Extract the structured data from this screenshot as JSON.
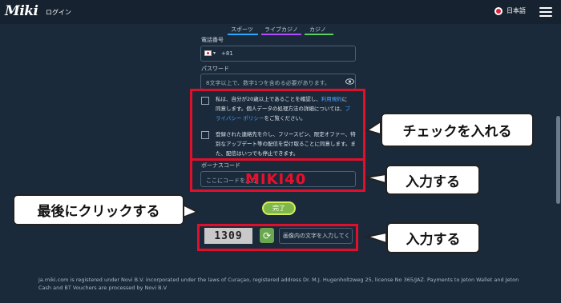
{
  "header": {
    "logo": "Miki",
    "login": "ログイン",
    "language": "日本語"
  },
  "tabs": [
    {
      "label": "スポーツ",
      "color": "#2aa7ff"
    },
    {
      "label": "ライブカジノ",
      "color": "#b44cff"
    },
    {
      "label": "カジノ",
      "color": "#5ad15a"
    }
  ],
  "form": {
    "phone_label": "電話番号",
    "phone_code": "+81",
    "password_label": "パスワード",
    "password_placeholder": "8文字以上で、数字1つを含める必要があります。",
    "consent1_part1": "私は、自分が20歳以上であることを確認し、",
    "consent1_link1": "利用規約",
    "consent1_part2": "に同意します。個人データの処理方法の詳細については、",
    "consent1_link2": "プライバシー ポリシー",
    "consent1_part3": "をご覧ください。",
    "consent2_text": "登録された連絡先を介し、フリースピン、限定オファー、特別なアップデート等の配信を受け取ることに同意します。また、配信はいつでも停止できます。",
    "bonus_label": "ボーナスコード",
    "bonus_placeholder": "ここにコードを入力",
    "promo_code": "MIKI40",
    "submit_label": "完了",
    "captcha_text": "1309",
    "captcha_placeholder": "画像内の文字を入力してく"
  },
  "callouts": {
    "check": "チェックを入れる",
    "input1": "入力する",
    "click_last": "最後にクリックする",
    "input2": "入力する"
  },
  "footer": {
    "line1": "ja.miki.com is registered under Novi B.V. incorporated under the laws of Curaçao, registered address Dr. M.J. Hugenholtzweg 25, license No 365/JAZ. Payments to Jeton Wallet and Jeton",
    "line2": "Cash and BT Vouchers are processed by Novi B.V"
  },
  "colors": {
    "accent_link": "#4aa3ff",
    "annotation_red": "#e0102c",
    "submit_green": "#7fb84a"
  }
}
